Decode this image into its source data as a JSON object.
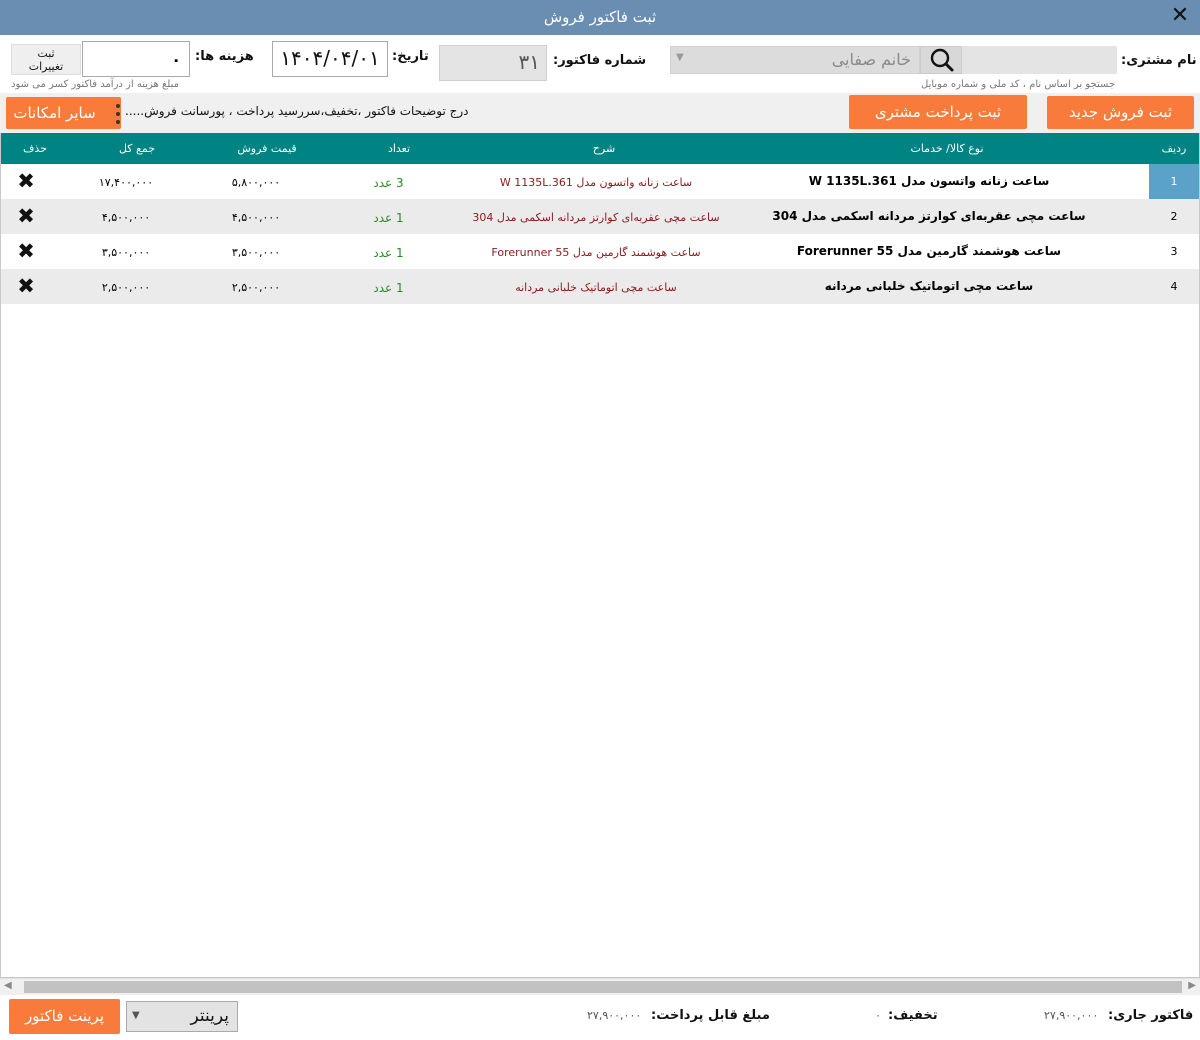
{
  "window": {
    "title": "ثبت فاکتور فروش",
    "close_glyph": "✕"
  },
  "header": {
    "customer_label": "نام مشتری:",
    "customer_search_value": "",
    "customer_hint": "جستجو بر اساس نام ، کد ملی و شماره موبایل",
    "customer_selected": "خانم صفایی",
    "invoice_no_label": "شماره فاکتور:",
    "invoice_no": "۳۱",
    "date_label": "تاریخ:",
    "date": "۱۴۰۴/۰۴/۰۱",
    "cost_label": "هزینه ها:",
    "cost_value": "۰",
    "cost_hint": "مبلغ هزینه از درآمد فاکتور کسر می شود",
    "save_changes_line1": "ثبت",
    "save_changes_line2": "تغییرات"
  },
  "actions": {
    "new_sale": "ثبت فروش جدید",
    "customer_payment": "ثبت پرداخت مشتری",
    "description_note": "درج توضیحات فاکتور ،تخفیف،سررسید پرداخت ، پورسانت فروش.....",
    "more_options": "سایر امکانات"
  },
  "table": {
    "columns": {
      "index": "ردیف",
      "name": "نوع کالا/ خدمات",
      "desc": "شرح",
      "qty": "تعداد",
      "price": "قیمت فروش",
      "total": "جمع کل",
      "delete": "حذف"
    },
    "rows": [
      {
        "index": "1",
        "name": "ساعت زنانه واتسون مدل W 1135L.361",
        "desc": "ساعت زنانه واتسون مدل W 1135L.361",
        "qty": "3 عدد",
        "price": "۵,۸۰۰,۰۰۰",
        "total": "۱۷,۴۰۰,۰۰۰",
        "delete": "✖",
        "selected": true
      },
      {
        "index": "2",
        "name": "ساعت مچی عقربه‌ای کوارتز مردانه اسکمی مدل 304",
        "desc": "ساعت مچی عقربه‌ای کوارتز مردانه اسکمی مدل 304",
        "qty": "1 عدد",
        "price": "۴,۵۰۰,۰۰۰",
        "total": "۴,۵۰۰,۰۰۰",
        "delete": "✖",
        "selected": false
      },
      {
        "index": "3",
        "name": "ساعت هوشمند گارمین مدل Forerunner 55",
        "desc": "ساعت هوشمند گارمین مدل Forerunner 55",
        "qty": "1 عدد",
        "price": "۳,۵۰۰,۰۰۰",
        "total": "۳,۵۰۰,۰۰۰",
        "delete": "✖",
        "selected": false
      },
      {
        "index": "4",
        "name": "ساعت مچی اتوماتیک خلبانی مردانه",
        "desc": "ساعت مچی اتوماتیک خلبانی مردانه",
        "qty": "1 عدد",
        "price": "۲,۵۰۰,۰۰۰",
        "total": "۲,۵۰۰,۰۰۰",
        "delete": "✖",
        "selected": false
      }
    ]
  },
  "footer": {
    "current_invoice_label": "فاکتور جاری:",
    "current_invoice_value": "۲۷,۹۰۰,۰۰۰",
    "discount_label": "تخفیف:",
    "discount_value": "۰",
    "payable_label": "مبلغ قابل پرداخت:",
    "payable_value": "۲۷,۹۰۰,۰۰۰",
    "printer_selected": "پرینتر",
    "print_button": "پرینت فاکتور"
  },
  "icons": {
    "search": "search-icon",
    "close": "close-icon",
    "delete": "delete-x-icon",
    "more": "vertical-dots-icon"
  },
  "colors": {
    "titlebar": "#6a8eb2",
    "accent_orange": "#f97b3b",
    "table_header": "#008483",
    "selected_row": "#5ba2c8"
  }
}
